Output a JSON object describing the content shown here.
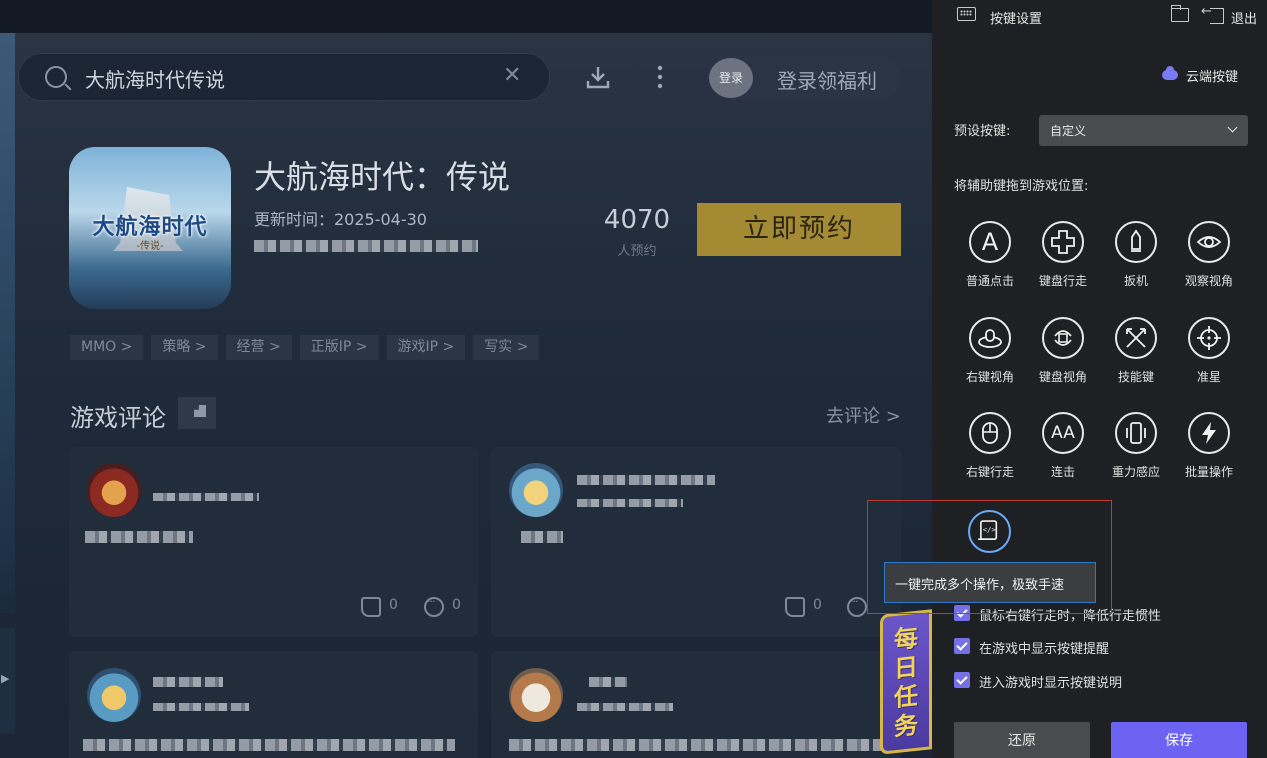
{
  "page": {
    "search": {
      "value": "大航海时代传说",
      "clear_icon": "close-icon"
    },
    "login": {
      "avatar_text": "登录",
      "label": "登录领福利"
    },
    "game": {
      "icon_logo": "大航海时代",
      "icon_logo_sub": "-传说-",
      "title": "大航海时代：传说",
      "update_time": "更新时间：2025-04-30",
      "reserve_count": "4070",
      "reserve_label": "人预约",
      "reserve_button": "立即预约"
    },
    "tags": [
      "MMO >",
      "策略 >",
      "经营 >",
      "正版IP >",
      "游戏IP >",
      "写实 >"
    ],
    "reviews": {
      "title": "游戏评论",
      "go_review": "去评论 >",
      "cards": [
        {
          "likes": "0",
          "comments": "0"
        },
        {
          "likes": "0",
          "comments": "0"
        }
      ]
    },
    "daily_task": "每日任务"
  },
  "panel": {
    "title": "按键设置",
    "exit_label": "退出",
    "cloud_label": "云端按键",
    "preset_label": "预设按键:",
    "preset_value": "自定义",
    "drag_hint": "将辅助键拖到游戏位置:",
    "keys": [
      {
        "label": "普通点击",
        "glyph": "A",
        "icon": "letter-a-icon"
      },
      {
        "label": "键盘行走",
        "glyph": "",
        "icon": "dpad-icon"
      },
      {
        "label": "扳机",
        "glyph": "",
        "icon": "bullet-icon"
      },
      {
        "label": "观察视角",
        "glyph": "",
        "icon": "eye-icon"
      },
      {
        "label": "右键视角",
        "glyph": "",
        "icon": "mouse-view-icon"
      },
      {
        "label": "键盘视角",
        "glyph": "",
        "icon": "rotate-view-icon"
      },
      {
        "label": "技能键",
        "glyph": "",
        "icon": "crossed-swords-icon"
      },
      {
        "label": "准星",
        "glyph": "",
        "icon": "crosshair-icon"
      },
      {
        "label": "右键行走",
        "glyph": "",
        "icon": "mouse-icon"
      },
      {
        "label": "连击",
        "glyph": "AA",
        "icon": "double-a-icon"
      },
      {
        "label": "重力感应",
        "glyph": "",
        "icon": "phone-vibrate-icon"
      },
      {
        "label": "批量操作",
        "glyph": "",
        "icon": "lightning-icon"
      }
    ],
    "macro_tooltip": "一键完成多个操作，极致手速",
    "checkboxes": [
      {
        "label": "鼠标右键行走时，降低行走惯性",
        "checked": true
      },
      {
        "label": "在游戏中显示按键提醒",
        "checked": true
      },
      {
        "label": "进入游戏时显示按键说明",
        "checked": true
      }
    ],
    "reset_button": "还原",
    "save_button": "保存",
    "colors": {
      "accent": "#6c63f2",
      "highlight_border": "#c0392b",
      "tooltip_border": "#2f79cc"
    }
  }
}
